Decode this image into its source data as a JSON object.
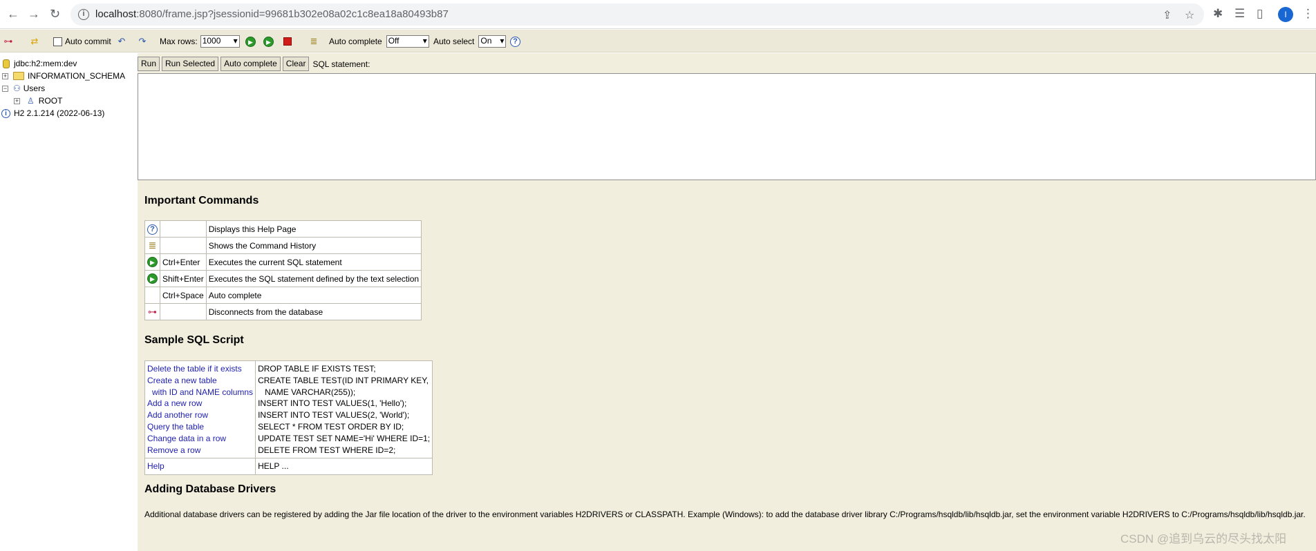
{
  "browser": {
    "url_host": "localhost",
    "url_rest": ":8080/frame.jsp?jsessionid=99681b302e08a02c1c8ea18a80493b87",
    "avatar_letter": "I"
  },
  "toolbar": {
    "auto_commit_label": "Auto commit",
    "max_rows_label": "Max rows:",
    "max_rows_value": "1000",
    "auto_complete_label": "Auto complete",
    "auto_complete_value": "Off",
    "auto_select_label": "Auto select",
    "auto_select_value": "On"
  },
  "tree": {
    "connection": "jdbc:h2:mem:dev",
    "schema": "INFORMATION_SCHEMA",
    "users": "Users",
    "root_user": "ROOT",
    "version": "H2 2.1.214 (2022-06-13)"
  },
  "query": {
    "run": "Run",
    "run_selected": "Run Selected",
    "auto_complete": "Auto complete",
    "clear": "Clear",
    "sql_label": "SQL statement:"
  },
  "help": {
    "important_title": "Important Commands",
    "commands": [
      {
        "icon": "help-icon",
        "key": "",
        "desc": "Displays this Help Page"
      },
      {
        "icon": "history-icon",
        "key": "",
        "desc": "Shows the Command History"
      },
      {
        "icon": "run-icon",
        "key": "Ctrl+Enter",
        "desc": "Executes the current SQL statement"
      },
      {
        "icon": "run-selected-icon",
        "key": "Shift+Enter",
        "desc": "Executes the SQL statement defined by the text selection"
      },
      {
        "icon": "",
        "key": "Ctrl+Space",
        "desc": "Auto complete"
      },
      {
        "icon": "disconnect-icon",
        "key": "",
        "desc": "Disconnects from the database"
      }
    ],
    "sample_title": "Sample SQL Script",
    "sample_links": [
      "Delete the table if it exists",
      "Create a new table",
      "with ID and NAME columns",
      "Add a new row",
      "Add another row",
      "Query the table",
      "Change data in a row",
      "Remove a row"
    ],
    "sample_sql": [
      "DROP TABLE IF EXISTS TEST;",
      "CREATE TABLE TEST(ID INT PRIMARY KEY,",
      "NAME VARCHAR(255));",
      "INSERT INTO TEST VALUES(1, 'Hello');",
      "INSERT INTO TEST VALUES(2, 'World');",
      "SELECT * FROM TEST ORDER BY ID;",
      "UPDATE TEST SET NAME='Hi' WHERE ID=1;",
      "DELETE FROM TEST WHERE ID=2;"
    ],
    "help_link": "Help",
    "help_sql": "HELP ...",
    "drivers_title": "Adding Database Drivers",
    "drivers_text": "Additional database drivers can be registered by adding the Jar file location of the driver to the environment variables H2DRIVERS or CLASSPATH. Example (Windows): to add the database driver library C:/Programs/hsqldb/lib/hsqldb.jar, set the environment variable H2DRIVERS to C:/Programs/hsqldb/lib/hsqldb.jar."
  },
  "watermark": "CSDN @追到乌云的尽头找太阳"
}
